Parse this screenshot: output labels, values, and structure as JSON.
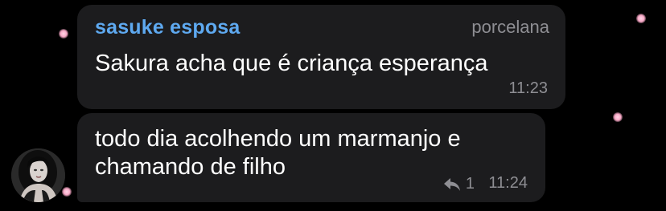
{
  "messages": [
    {
      "sender": "sasuke esposa",
      "role": "porcelana",
      "lines": [
        "Sakura acha que é criança esperança"
      ],
      "time": "11:23"
    },
    {
      "lines": [
        "todo dia acolhendo um marmanjo e",
        "chamando de filho"
      ],
      "reply_count": "1",
      "time": "11:24"
    }
  ],
  "icons": {
    "reply": "reply-arrow-icon",
    "avatar": "profile-photo"
  },
  "colors": {
    "background": "#000000",
    "bubble": "#1c1c1e",
    "sender_name": "#5ea9f0",
    "meta_text": "#8e8e93",
    "message_text": "#ffffff",
    "dots": "#f7a8c6"
  }
}
